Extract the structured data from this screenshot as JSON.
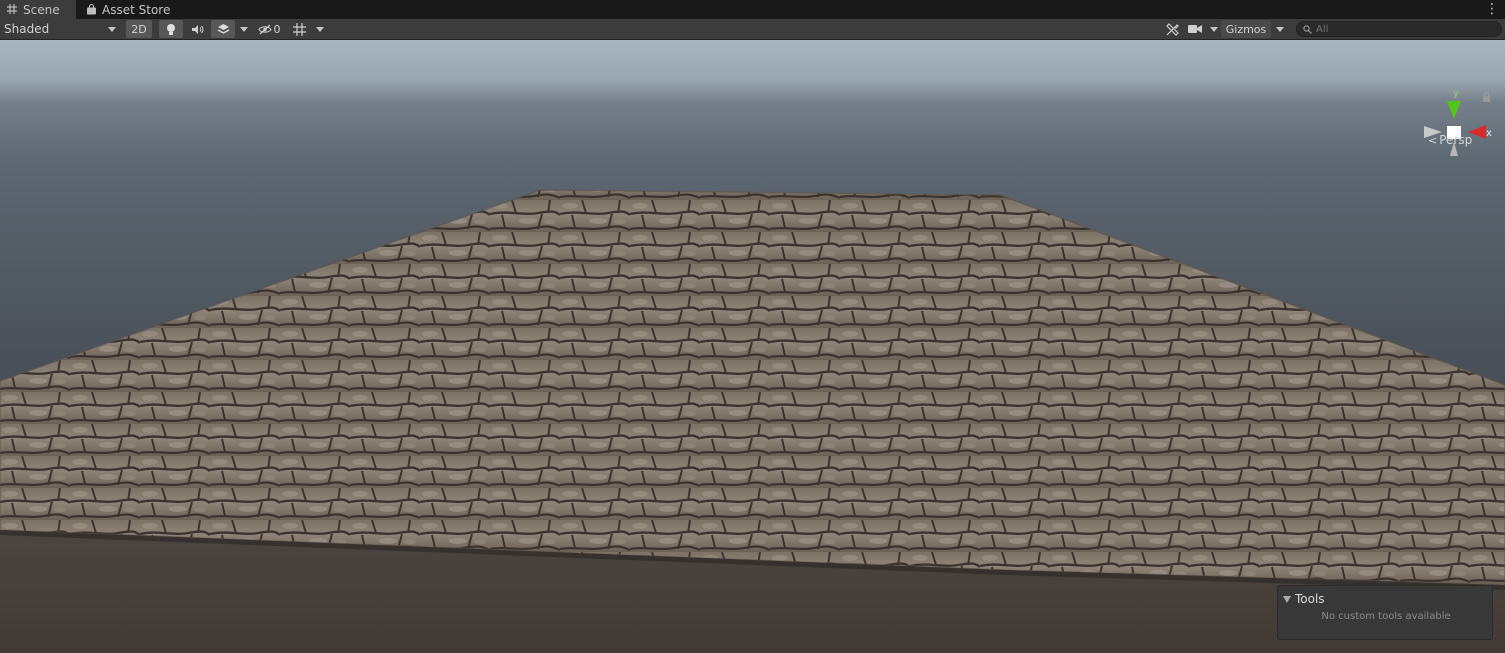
{
  "tabs": [
    {
      "label": "Scene",
      "icon": "grid-icon"
    },
    {
      "label": "Asset Store",
      "icon": "bag-icon"
    }
  ],
  "toolbar": {
    "draw_mode": "Shaded",
    "two_d": "2D",
    "hidden_count": "0",
    "gizmos": "Gizmos"
  },
  "search": {
    "placeholder": "All"
  },
  "gizmo": {
    "x_label": "x",
    "y_label": "y"
  },
  "projection": "Persp",
  "tools_overlay": {
    "title": "Tools",
    "message": "No custom tools available"
  },
  "colors": {
    "x_axis": "#d62b2b",
    "y_axis": "#52c41a",
    "editor_bg": "#3c3c3c"
  }
}
